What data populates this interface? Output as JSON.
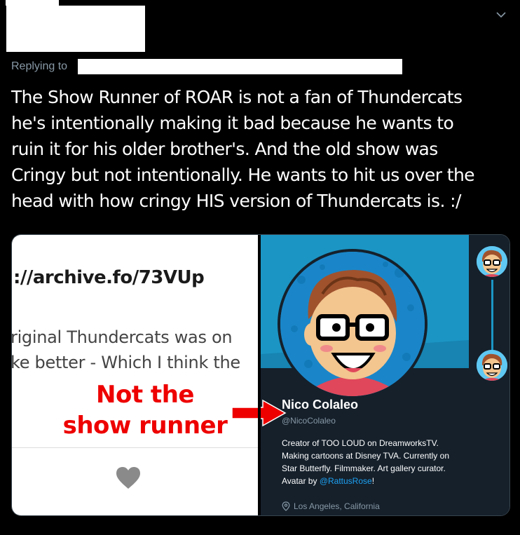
{
  "header": {
    "replying_label": "Replying to",
    "menu_icon": "chevron-down-icon"
  },
  "tweet": {
    "text": "The Show Runner of ROAR is not a fan of Thundercats\nhe's intentionally making it bad because he wants to\nruin it for his older brother's.  And the old show was\nCringy but not intentionally. He wants to hit us over the\nhead with how cringy HIS version of Thundercats is. :/"
  },
  "media": {
    "left": {
      "url_text": "://archive.fo/73VUp",
      "snippet_line1": "riginal Thundercats was on",
      "snippet_line2": "ke better - Which I think the",
      "heart_icon": "heart-icon"
    },
    "annotation": {
      "line1": "Not the",
      "line2": "show runner",
      "color": "#ee0000"
    },
    "profile": {
      "name": "Nico Colaleo",
      "handle": "@NicoColaleo",
      "bio_text": "Creator of TOO LOUD on DreamworksTV. Making cartoons at Disney TVA. Currently on Star Butterfly. Filmmaker. Art gallery curator. Avatar by ",
      "bio_mention": "@RattusRose",
      "bio_end": "!",
      "location": "Los Angeles, California",
      "banner_color": "#1b95c4",
      "link_color": "#1da1f2"
    }
  }
}
